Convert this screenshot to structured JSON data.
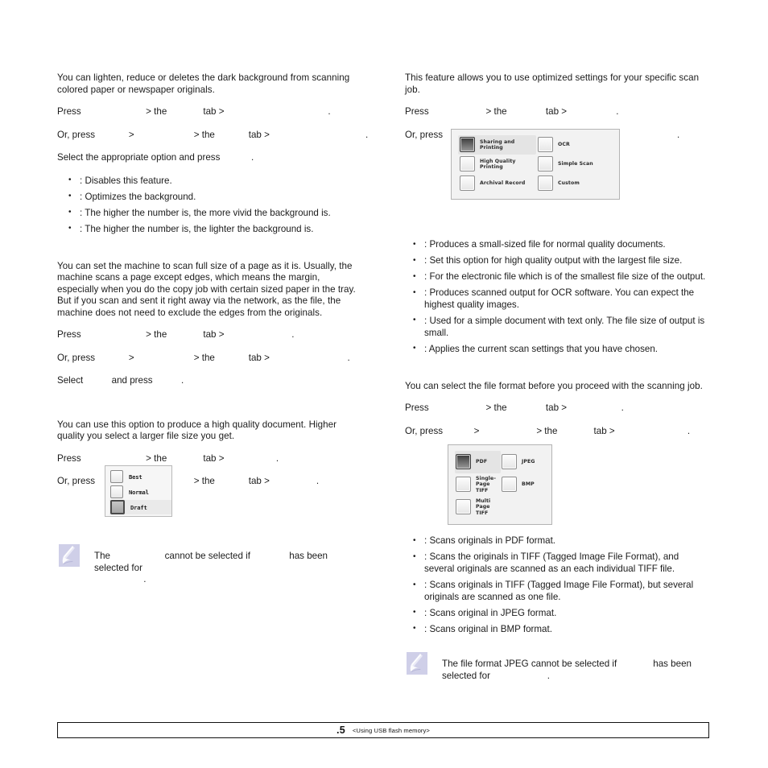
{
  "document": {
    "footer": {
      "page_number": ".5",
      "section_title": "<Using USB flash memory>"
    }
  },
  "left_column": {
    "sections": [
      {
        "id": "background-removal",
        "intro": "You can lighten, reduce or deletes the dark background from scanning colored paper or newspaper originals.",
        "steps": [
          "Press                         > the              tab >                                        .",
          "Or, press             >                       > the             tab >                                     .",
          "Select the appropriate option and press            ."
        ],
        "bullets": [
          ": Disables this feature.",
          "      : Optimizes the background.",
          "              : The higher the number is, the more vivid the background is.",
          "            : The higher the number is, the lighter the background is."
        ]
      },
      {
        "id": "scan-to-edge",
        "intro": "You can set the machine to scan full size of a page as it is. Usually, the machine scans a page except edges, which means the margin, especially when you do the copy job with certain sized paper in the tray. But if you scan and sent it right away via the network, as the file, the machine does not need to exclude the edges from the originals.",
        "steps": [
          "Press                         > the              tab >                          .",
          "Or, press             >                       > the             tab >                              .",
          "Select           and press           ."
        ]
      },
      {
        "id": "quality",
        "intro": "You can use this option to produce a high quality document. Higher quality you select a larger file size you get.",
        "steps": [
          "Press                         > the              tab >                    .",
          "Or, press             >                       > the             tab >                  ."
        ]
      }
    ],
    "quality_widget": {
      "name": "quality-options-panel",
      "options": [
        {
          "label": "Best",
          "selected": false
        },
        {
          "label": "Normal",
          "selected": false
        },
        {
          "label": "Draft",
          "selected": true
        }
      ]
    },
    "note": {
      "icon": "note-pen-icon",
      "text": "The                     cannot be selected if               has been selected for\n                   ."
    }
  },
  "right_column": {
    "sections": [
      {
        "id": "scan-preset",
        "intro": "This feature allows you to use optimized settings for your specific scan job.",
        "steps": [
          "Press                      > the               tab >                   .",
          "Or, press            >                      > the              tab >                        ."
        ],
        "bullets": [
          "                                  : Produces a small-sized file for normal quality documents.",
          "                                   : Set this option for high quality output with the largest file size.",
          "                          : For the electronic file which is of the smallest file size of the output.",
          "            : Produces scanned output for OCR software. You can expect the highest quality images.",
          "                        : Used for a simple document with text only. The file size of output is small.",
          "                   : Applies the current scan settings that you have chosen."
        ]
      },
      {
        "id": "file-format",
        "intro": "You can select the file format before you proceed with the scanning job.",
        "steps": [
          "Press                      > the               tab >                     .",
          "Or, press            >                      > the              tab >                            ."
        ],
        "bullets": [
          "           : Scans originals in PDF format.",
          "                                : Scans the originals in TIFF (Tagged Image File Format), and several originals are scanned as an each individual TIFF file.",
          "                             : Scans originals in TIFF (Tagged Image File Format), but several originals are scanned as one file.",
          "              : Scans original in JPEG format.",
          "            : Scans original in BMP format."
        ]
      }
    ],
    "preset_widget": {
      "name": "scan-preset-panel",
      "options": [
        {
          "label": "Sharing and\nPrinting",
          "selected": true
        },
        {
          "label": "OCR",
          "selected": false
        },
        {
          "label": "High Quality\nPrinting",
          "selected": false
        },
        {
          "label": "Simple Scan",
          "selected": false
        },
        {
          "label": "Archival Record",
          "selected": false
        },
        {
          "label": "Custom",
          "selected": false
        }
      ]
    },
    "format_widget": {
      "name": "file-format-panel",
      "options": [
        {
          "label": "PDF",
          "selected": true
        },
        {
          "label": "JPEG",
          "selected": false
        },
        {
          "label": "Single-Page\nTIFF",
          "selected": false
        },
        {
          "label": "BMP",
          "selected": false
        },
        {
          "label": "Multi Page\nTIFF",
          "selected": false
        }
      ]
    },
    "note": {
      "icon": "note-pen-icon",
      "text": "The file format JPEG cannot be selected if              has been\nselected for                      ."
    }
  },
  "colors": {
    "note_icon_bg": "#cfcfe8",
    "lcd_bg": "#f2f2f2",
    "lcd_border": "#b4b4b4",
    "text": "#1b1b1b"
  }
}
